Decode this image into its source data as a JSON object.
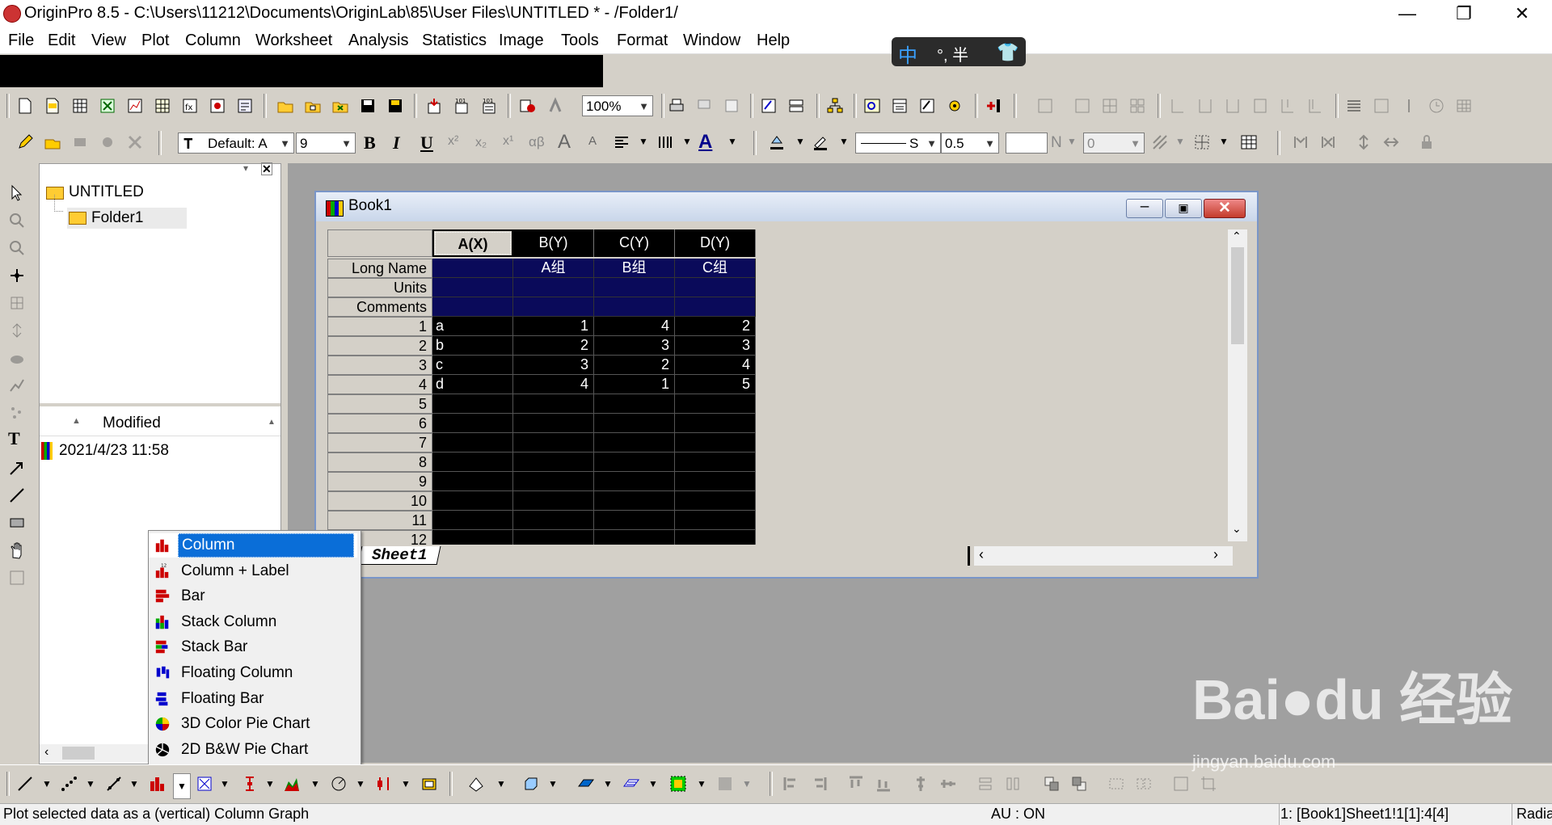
{
  "window": {
    "title": "OriginPro 8.5 - C:\\Users\\11212\\Documents\\OriginLab\\85\\User Files\\UNTITLED * - /Folder1/",
    "min": "—",
    "max": "❐",
    "close": "✕"
  },
  "menu": [
    "File",
    "Edit",
    "View",
    "Plot",
    "Column",
    "Worksheet",
    "Analysis",
    "Statistics",
    "Image",
    "Tools",
    "Format",
    "Window",
    "Help"
  ],
  "ime": {
    "main": "中",
    "rest": "°, 半"
  },
  "toolbar": {
    "zoom": "100%",
    "font": "Default: A",
    "font_size": "9",
    "line_width": "0.5",
    "line_style": "S",
    "n_label": "N",
    "zero": "0",
    "bold": "B",
    "italic": "I",
    "underline": "U"
  },
  "explorer": {
    "root": "UNTITLED",
    "folder": "Folder1",
    "modified_header": "Modified",
    "modified_value": "2021/4/23 11:58"
  },
  "book": {
    "title": "Book1",
    "columns": [
      "A(X)",
      "B(Y)",
      "C(Y)",
      "D(Y)"
    ],
    "row_labels": [
      "Long Name",
      "Units",
      "Comments"
    ],
    "long_names": [
      "",
      "A组",
      "B组",
      "C组"
    ],
    "rows": [
      [
        "1",
        "a",
        "1",
        "4",
        "2"
      ],
      [
        "2",
        "b",
        "2",
        "3",
        "3"
      ],
      [
        "3",
        "c",
        "3",
        "2",
        "4"
      ],
      [
        "4",
        "d",
        "4",
        "1",
        "5"
      ],
      [
        "5",
        "",
        "",
        "",
        ""
      ],
      [
        "6",
        "",
        "",
        "",
        ""
      ],
      [
        "7",
        "",
        "",
        "",
        ""
      ],
      [
        "8",
        "",
        "",
        "",
        ""
      ],
      [
        "9",
        "",
        "",
        "",
        ""
      ],
      [
        "10",
        "",
        "",
        "",
        ""
      ],
      [
        "11",
        "",
        "",
        "",
        ""
      ],
      [
        "12",
        "",
        "",
        "",
        ""
      ]
    ],
    "sheet_tab": "Sheet1"
  },
  "popup": {
    "items": [
      "Column",
      "Column + Label",
      "Bar",
      "Stack Column",
      "Stack Bar",
      "Floating Column",
      "Floating Bar",
      "3D Color Pie Chart",
      "2D B&W Pie Chart"
    ],
    "selected": "Column",
    "icons": [
      "column-chart-icon",
      "column-label-icon",
      "bar-chart-icon",
      "stack-column-icon",
      "stack-bar-icon",
      "floating-column-icon",
      "floating-bar-icon",
      "color-pie-icon",
      "bw-pie-icon"
    ]
  },
  "status": {
    "hint": "Plot selected data as a (vertical) Column Graph",
    "au": "AU : ON",
    "cell": "1: [Book1]Sheet1!1[1]:4[4]",
    "angle": "Radian"
  },
  "watermark": {
    "brand": "Bai●du 经验",
    "url": "jingyan.baidu.com"
  },
  "colors": {
    "selection": "#0a6ed8",
    "navy": "#0a0a5a",
    "title_gradient": "#c9d6ea",
    "close_red": "#c43c2c"
  }
}
